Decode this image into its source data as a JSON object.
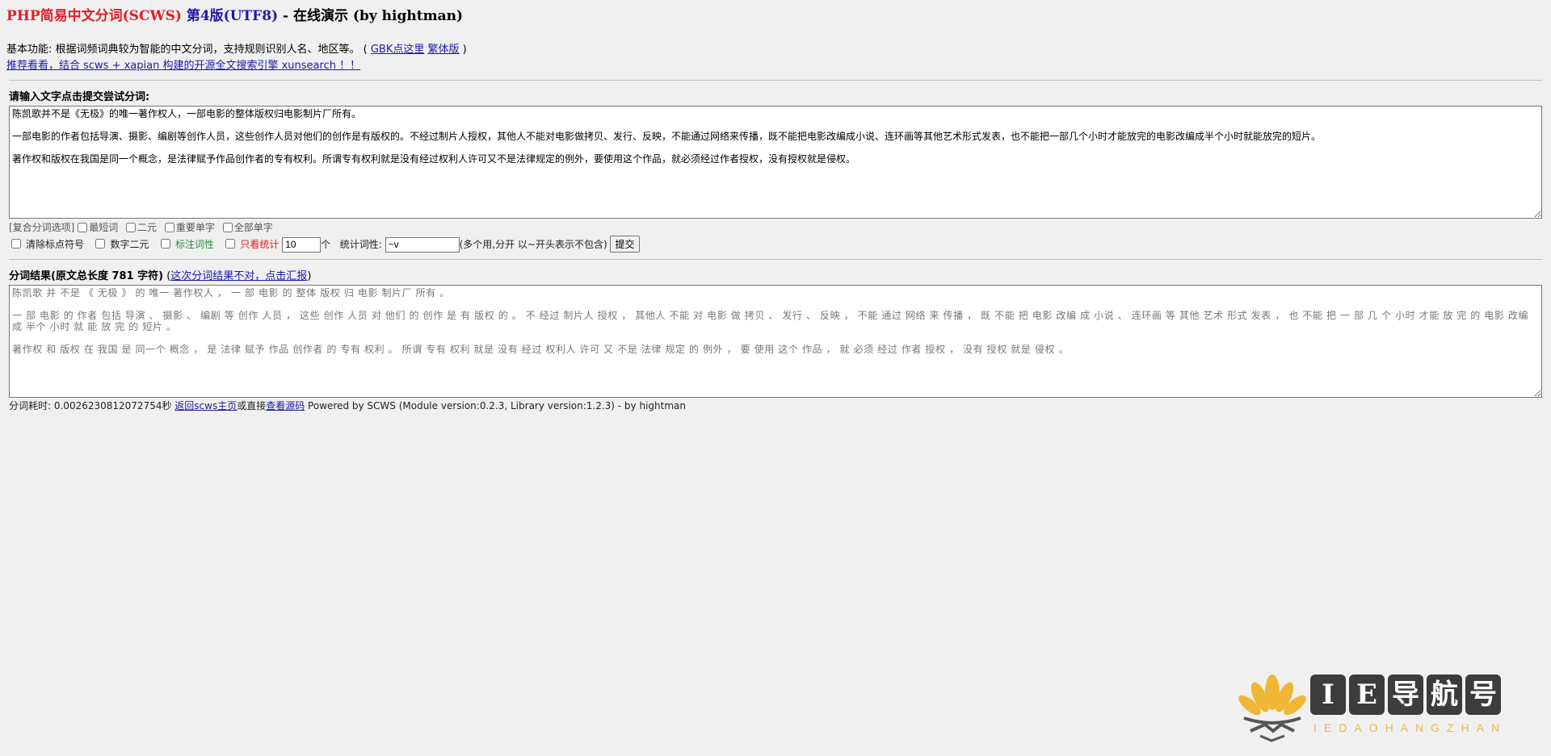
{
  "title": {
    "part_red": "PHP简易中文分词(SCWS)",
    "part_blue": "第4版(UTF8)",
    "part_black": " - 在线演示 (by hightman)"
  },
  "intro": {
    "features_text": "基本功能: 根据词频词典较为智能的中文分词，支持规则识别人名、地区等。 ( ",
    "gbk_link": "GBK点这里",
    "trad_link": "繁体版",
    "close_paren": " )",
    "recommend_link": "推荐看看，结合 scws + xapian 构建的开源全文搜索引擎 xunsearch ！！"
  },
  "input_section": {
    "label": "请输入文字点击提交尝试分词:",
    "text": "陈凯歌并不是《无极》的唯一著作权人，一部电影的整体版权归电影制片厂所有。\n\n一部电影的作者包括导演、摄影、编剧等创作人员，这些创作人员对他们的创作是有版权的。不经过制片人授权，其他人不能对电影做拷贝、发行、反映，不能通过网络来传播，既不能把电影改编成小说、连环画等其他艺术形式发表，也不能把一部几个小时才能放完的电影改编成半个小时就能放完的短片。\n\n著作权和版权在我国是同一个概念，是法律赋予作品创作者的专有权利。所谓专有权利就是没有经过权利人许可又不是法律规定的例外，要使用这个作品，就必须经过作者授权，没有授权就是侵权。"
  },
  "options": {
    "group_label": "[复合分词选项]",
    "shortest": "最短词",
    "duality": "二元",
    "important_single": "重要单字",
    "all_single": "全部单字",
    "clear_punct": "清除标点符号",
    "digit_duality": "数字二元",
    "show_attr": "标注词性",
    "stats_only": "只看统计",
    "count_value": "10",
    "count_unit": "个",
    "attr_label": "统计词性:",
    "attr_value": "~v",
    "attr_hint": "(多个用,分开 以~开头表示不包含)",
    "submit": "提交"
  },
  "result_section": {
    "label": "分词结果(原文总长度 781 字符)",
    "report_open": " (",
    "report_link": "这次分词结果不对，点击汇报",
    "report_close": ")",
    "text": "陈凯歌 并 不是 《 无极 》 的 唯一 著作权人 ， 一 部 电影 的 整体 版权 归 电影 制片厂 所有 。\n\n一 部 电影 的 作者 包括 导演 、 摄影 、 编剧 等 创作 人员 ， 这些 创作 人员 对 他们 的 创作 是 有 版权 的 。 不 经过 制片人 授权 ， 其他人 不能 对 电影 做 拷贝 、 发行 、 反映 ， 不能 通过 网络 来 传播 ， 既 不能 把 电影 改编 成 小说 、 连环画 等 其他 艺术 形式 发表 ， 也 不能 把 一 部 几 个 小时 才能 放 完 的 电影 改编 成 半个 小时 就 能 放 完 的 短片 。\n\n著作权 和 版权 在 我国 是 同一个 概念 ， 是 法律 赋予 作品 创作者 的 专有 权利 。 所谓 专有 权利 就是 没有 经过 权利人 许可 又 不是 法律 规定 的 例外 ， 要 使用 这个 作品 ， 就 必须 经过 作者 授权 ， 没有 授权 就是 侵权 。"
  },
  "footer": {
    "timing": "分词耗时: 0.0026230812072754秒 ",
    "home_link": "返回scws主页",
    "or_text": "或直接",
    "source_link": "查看源码",
    "powered": " Powered by SCWS (Module version:0.2.3, Library version:1.2.3) - by hightman"
  },
  "watermark": {
    "letters": [
      "I",
      "E",
      "导",
      "航",
      "号"
    ],
    "sub": "IEDAOHANGZHAN"
  }
}
